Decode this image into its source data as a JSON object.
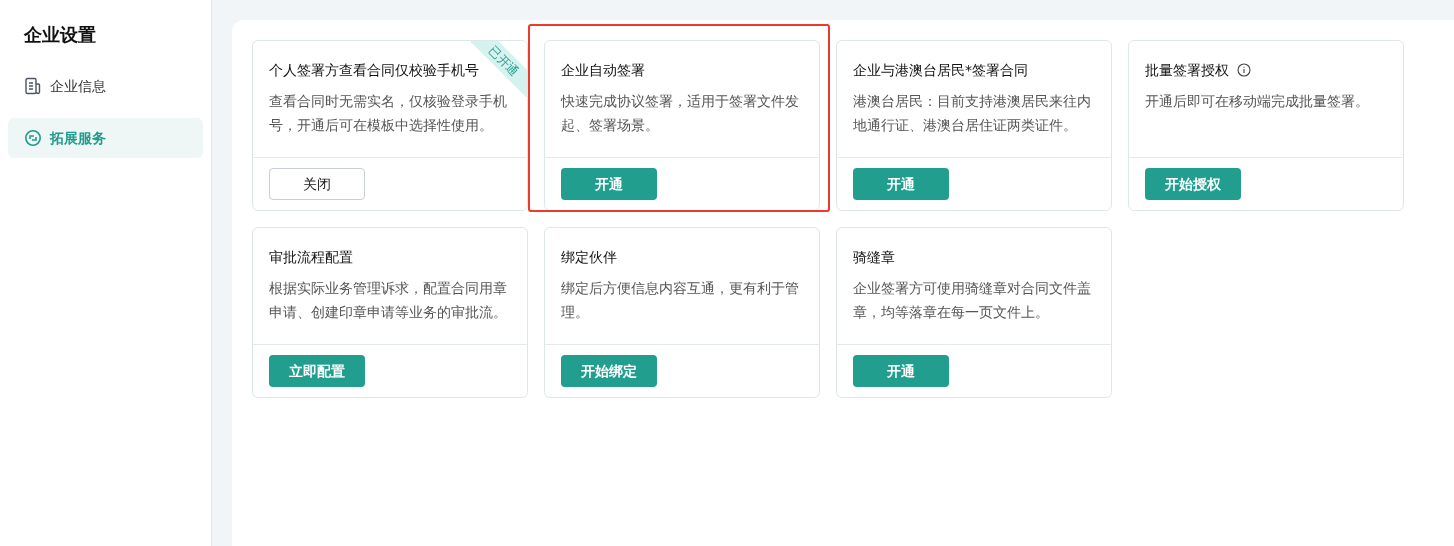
{
  "sidebar": {
    "title": "企业设置",
    "items": [
      {
        "label": "企业信息",
        "kind": "document",
        "selected": false
      },
      {
        "label": "拓展服务",
        "kind": "loop",
        "selected": true
      }
    ]
  },
  "cards": [
    {
      "title": "个人签署方查看合同仅校验手机号",
      "description": "查看合同时无需实名，仅核验登录手机号，开通后可在模板中选择性使用。",
      "badge": "已开通",
      "info": false,
      "highlighted": false,
      "button": {
        "label": "关闭",
        "kind": "outline"
      }
    },
    {
      "title": "企业自动签署",
      "description": "快速完成协议签署，适用于签署文件发起、签署场景。",
      "info": false,
      "highlighted": true,
      "button": {
        "label": "开通",
        "kind": "primary"
      }
    },
    {
      "title": "企业与港澳台居民*签署合同",
      "description": "港澳台居民：目前支持港澳居民来往内地通行证、港澳台居住证两类证件。",
      "info": false,
      "highlighted": false,
      "button": {
        "label": "开通",
        "kind": "primary"
      }
    },
    {
      "title": "批量签署授权",
      "description": "开通后即可在移动端完成批量签署。",
      "info": true,
      "highlighted": false,
      "button": {
        "label": "开始授权",
        "kind": "primary"
      }
    },
    {
      "title": "审批流程配置",
      "description": "根据实际业务管理诉求，配置合同用章申请、创建印章申请等业务的审批流。",
      "info": false,
      "highlighted": false,
      "button": {
        "label": "立即配置",
        "kind": "primary"
      }
    },
    {
      "title": "绑定伙伴",
      "description": "绑定后方便信息内容互通，更有利于管理。",
      "info": false,
      "highlighted": false,
      "button": {
        "label": "开始绑定",
        "kind": "primary"
      }
    },
    {
      "title": "骑缝章",
      "description": "企业签署方可使用骑缝章对合同文件盖章，均等落章在每一页文件上。",
      "info": false,
      "highlighted": false,
      "button": {
        "label": "开通",
        "kind": "primary"
      }
    }
  ]
}
